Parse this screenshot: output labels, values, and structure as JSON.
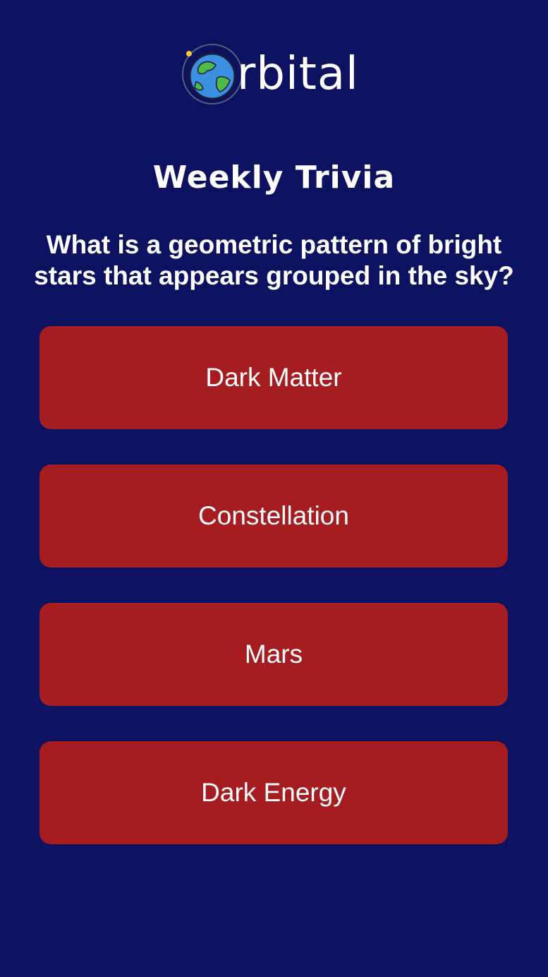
{
  "header": {
    "logo_text": "rbital"
  },
  "title": "Weekly Trivia",
  "question": "What is a geometric pattern of bright stars that appears grouped in the sky?",
  "answers": [
    {
      "label": "Dark Matter"
    },
    {
      "label": "Constellation"
    },
    {
      "label": "Mars"
    },
    {
      "label": "Dark Energy"
    }
  ],
  "colors": {
    "background": "#0c1160",
    "answer_button": "#a51d21",
    "text": "#ffffff"
  }
}
